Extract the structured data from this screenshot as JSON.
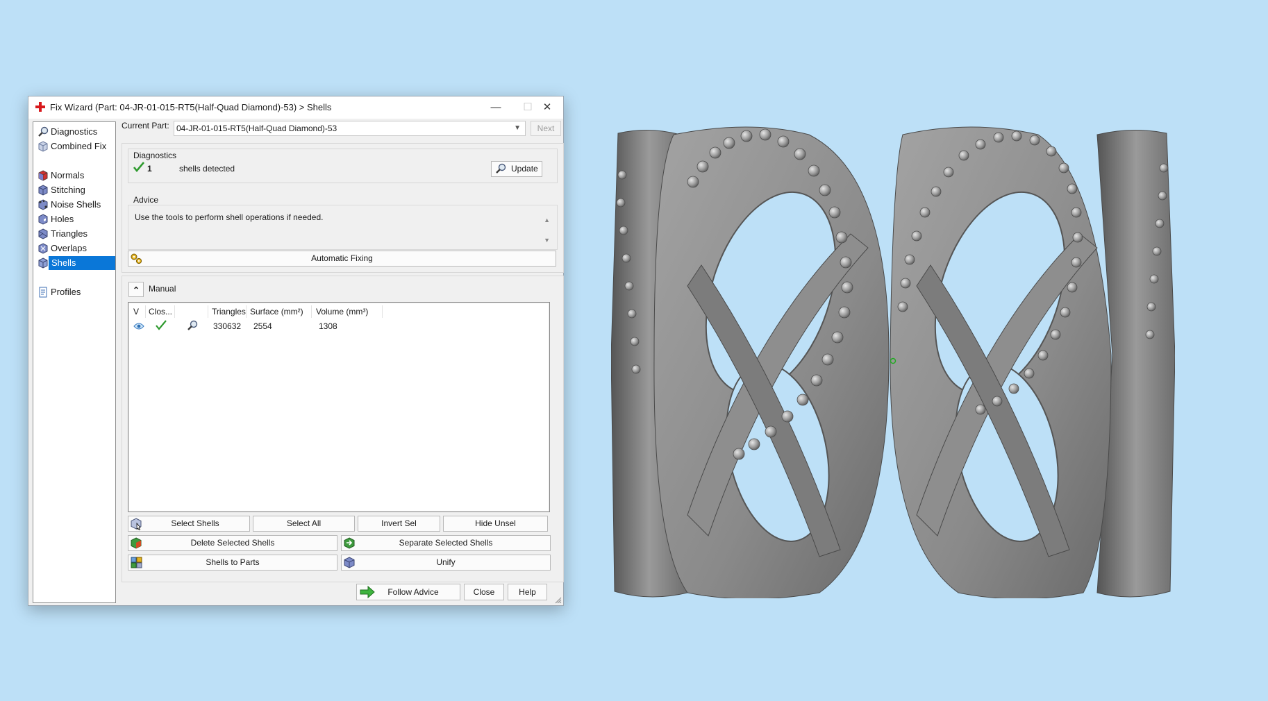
{
  "window": {
    "title": "Fix Wizard (Part: 04-JR-01-015-RT5(Half-Quad Diamond)-53) > Shells",
    "minimize_glyph": "—",
    "maximize_glyph": "☐",
    "close_glyph": "✕"
  },
  "sidebar": {
    "items": [
      {
        "label": "Diagnostics",
        "icon": "diagnostics-icon"
      },
      {
        "label": "Combined Fix",
        "icon": "combined-fix-icon"
      },
      {
        "label": "Normals",
        "icon": "normals-icon"
      },
      {
        "label": "Stitching",
        "icon": "stitching-icon"
      },
      {
        "label": "Noise Shells",
        "icon": "noise-shells-icon"
      },
      {
        "label": "Holes",
        "icon": "holes-icon"
      },
      {
        "label": "Triangles",
        "icon": "triangles-icon"
      },
      {
        "label": "Overlaps",
        "icon": "overlaps-icon"
      },
      {
        "label": "Shells",
        "icon": "shells-icon",
        "active": true
      },
      {
        "label": "Profiles",
        "icon": "profiles-icon"
      }
    ]
  },
  "current_part": {
    "label": "Current Part:",
    "value": "04-JR-01-015-RT5(Half-Quad Diamond)-53",
    "next_label": "Next"
  },
  "diagnostics": {
    "title": "Diagnostics",
    "count": "1",
    "status_text": "shells detected",
    "update_label": "Update"
  },
  "advice": {
    "title": "Advice",
    "text": "Use the tools to perform shell operations if needed.",
    "scroll_up": "▲",
    "scroll_down": "▼"
  },
  "automatic_fixing_label": "Automatic Fixing",
  "manual": {
    "title": "Manual",
    "collapse_glyph": "⌃",
    "columns": [
      "V",
      "Clos...",
      "",
      "Triangles",
      "Surface (mm²)",
      "Volume (mm³)"
    ],
    "rows": [
      {
        "triangles": "330632",
        "surface": "2554",
        "volume": "1308"
      }
    ]
  },
  "actions": {
    "select_shells": "Select Shells",
    "select_all": "Select All",
    "invert_sel": "Invert Sel",
    "hide_unsel": "Hide Unsel",
    "delete_selected": "Delete Selected Shells",
    "separate_selected": "Separate Selected Shells",
    "shells_to_parts": "Shells to Parts",
    "unify": "Unify"
  },
  "footer": {
    "follow_advice": "Follow Advice",
    "close": "Close",
    "help": "Help"
  },
  "colors": {
    "background": "#bde0f7",
    "selection": "#0a77d8",
    "model": "#8c8c8c",
    "check": "#2e9a2e"
  }
}
